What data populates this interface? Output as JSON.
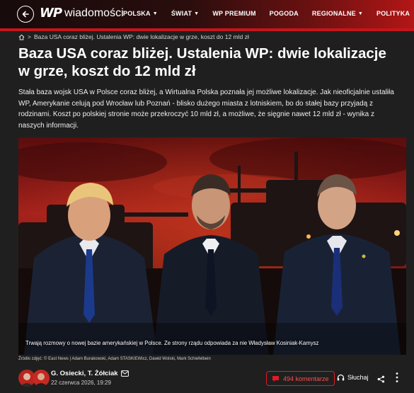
{
  "brand": {
    "logo_mark": "WP",
    "name": "wiadomości"
  },
  "nav": [
    {
      "label": "POLSKA",
      "dropdown": true
    },
    {
      "label": "ŚWIAT",
      "dropdown": true
    },
    {
      "label": "WP PREMIUM",
      "dropdown": false
    },
    {
      "label": "POGODA",
      "dropdown": false
    },
    {
      "label": "REGIONALNE",
      "dropdown": true
    },
    {
      "label": "POLITYKA",
      "dropdown": false
    }
  ],
  "breadcrumb": {
    "separator": ">",
    "current": "Baza USA coraz bliżej. Ustalenia WP: dwie lokalizacje w grze, koszt do 12 mld zł"
  },
  "article": {
    "title": "Baza USA coraz bliżej. Ustalenia WP: dwie lokalizacje w grze, koszt do 12 mld zł",
    "lead": "Stała baza wojsk USA w Polsce coraz bliżej, a Wirtualna Polska poznała jej możliwe lokalizacje. Jak nieoficjalnie ustaliła WP, Amerykanie celują pod Wrocław lub Poznań - blisko dużego miasta z lotniskiem, bo do stałej bazy przyjadą z rodzinami. Koszt po polskiej stronie może przekroczyć 10 mld zł, a możliwe, że sięgnie nawet 12 mld zł - wynika z naszych informacji.",
    "image_caption": "Trwają rozmowy o nowej bazie amerykańskiej w Polsce. Ze strony rządu odpowiada za nie Władysław Kosiniak-Kamysz",
    "image_credits": "Źródło zdjęć: © East News | Adam Burakowski, Adam STASKIEWicz, Dawid Wolski, Mark Schiefelbein"
  },
  "meta": {
    "authors": "G. Osiecki, T. Żółciak",
    "date": "22 czerwca 2026, 19:29",
    "comments_label": "494 komentarze",
    "listen_label": "Słuchaj"
  },
  "icons": [
    "back-arrow-icon",
    "home-icon",
    "mail-icon",
    "comment-icon",
    "headphones-icon",
    "share-icon",
    "more-icon"
  ],
  "colors": {
    "accent_red": "#e01b22",
    "background": "#1f1f1f",
    "text": "#ffffff"
  }
}
